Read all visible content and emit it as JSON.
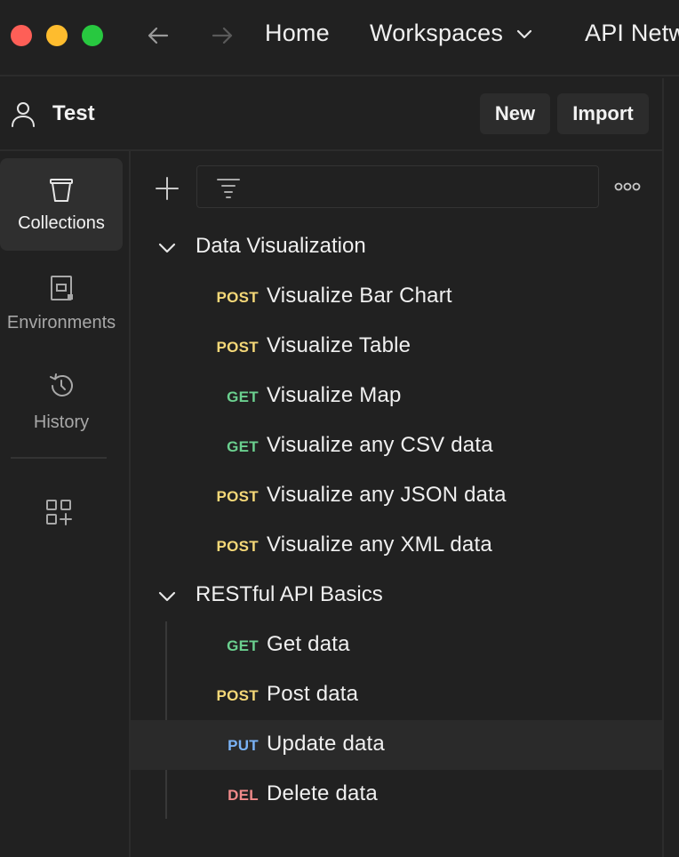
{
  "titlebar": {
    "nav": {
      "home": "Home",
      "workspaces": "Workspaces",
      "api_network": "API Netw"
    }
  },
  "workspace": {
    "name": "Test",
    "new_label": "New",
    "import_label": "Import"
  },
  "sidebar": {
    "items": [
      {
        "label": "Collections",
        "icon": "collections-icon",
        "active": true
      },
      {
        "label": "Environments",
        "icon": "environments-icon",
        "active": false
      },
      {
        "label": "History",
        "icon": "history-icon",
        "active": false
      }
    ],
    "configure_icon": "configure-workbench-icon"
  },
  "filter": {
    "value": ""
  },
  "collections": [
    {
      "name": "Data Visualization",
      "expanded": true,
      "requests": [
        {
          "method": "POST",
          "name": "Visualize Bar Chart"
        },
        {
          "method": "POST",
          "name": "Visualize Table"
        },
        {
          "method": "GET",
          "name": "Visualize Map"
        },
        {
          "method": "GET",
          "name": "Visualize any CSV data"
        },
        {
          "method": "POST",
          "name": "Visualize any JSON data"
        },
        {
          "method": "POST",
          "name": "Visualize any XML data"
        }
      ]
    },
    {
      "name": "RESTful API Basics",
      "expanded": true,
      "requests": [
        {
          "method": "GET",
          "name": "Get data"
        },
        {
          "method": "POST",
          "name": "Post data"
        },
        {
          "method": "PUT",
          "name": "Update data"
        },
        {
          "method": "DEL",
          "name": "Delete data"
        }
      ]
    }
  ],
  "colors": {
    "background": "#212121",
    "post": "#f5d878",
    "get": "#6bd08f",
    "put": "#7ab2f5",
    "del": "#f08a8a"
  }
}
